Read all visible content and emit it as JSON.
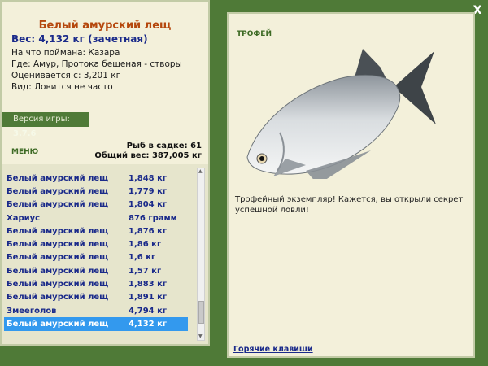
{
  "window": {
    "close_label": "X"
  },
  "fish_info": {
    "title": "Белый амурский лещ",
    "weight": "Вес: 4,132 кг (зачетная)",
    "bait": "На что поймана: Казара",
    "location": "Где: Амур, Протока бешеная - створы",
    "value": "Оценивается с: 3,201 кг",
    "rarity": "Вид: Ловится не часто"
  },
  "version": {
    "label": "Версия игры: ",
    "value": "3.7.6"
  },
  "menu_label": "МЕНЮ",
  "stats": {
    "in_keepnet": "Рыб в садке: 61",
    "total_weight": "Общий вес: 387,005 кг"
  },
  "catch_list": [
    {
      "name": "Белый амурский лещ",
      "weight": "1,848 кг"
    },
    {
      "name": "Белый амурский лещ",
      "weight": "1,779 кг"
    },
    {
      "name": "Белый амурский лещ",
      "weight": "1,804 кг"
    },
    {
      "name": "Хариус",
      "weight": "876 грамм"
    },
    {
      "name": "Белый амурский лещ",
      "weight": "1,876 кг"
    },
    {
      "name": "Белый амурский лещ",
      "weight": "1,86 кг"
    },
    {
      "name": "Белый амурский лещ",
      "weight": "1,6 кг"
    },
    {
      "name": "Белый амурский лещ",
      "weight": "1,57 кг"
    },
    {
      "name": "Белый амурский лещ",
      "weight": "1,883 кг"
    },
    {
      "name": "Белый амурский лещ",
      "weight": "1,891 кг"
    },
    {
      "name": "Змееголов",
      "weight": "4,794 кг"
    },
    {
      "name": "Белый амурский лещ",
      "weight": "4,132 кг",
      "selected": true
    }
  ],
  "trophy": {
    "label": "ТРОФЕЙ",
    "description": "Трофейный экземпляр! Кажется, вы открыли секрет успешной ловли!",
    "hotkeys_link": "Горячие клавиши"
  },
  "colors": {
    "background": "#4f7a37",
    "panel": "#f3f0da",
    "title": "#b5470d",
    "text_blue": "#1a2a8a",
    "selected": "#3399ee"
  }
}
